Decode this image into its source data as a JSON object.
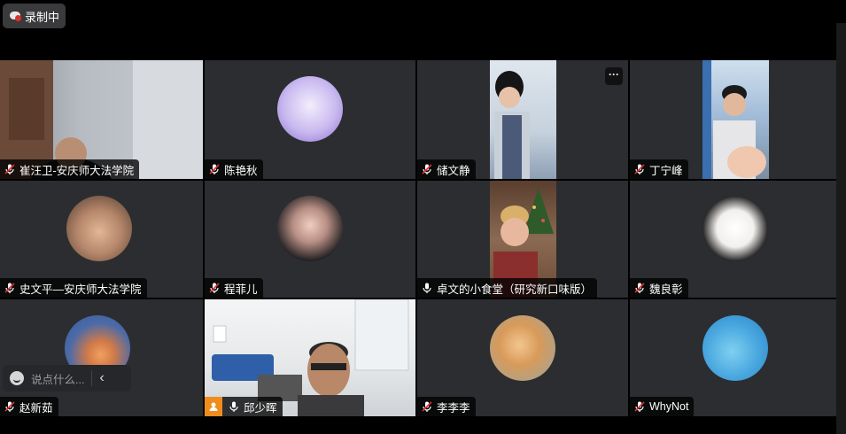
{
  "recording": {
    "label": "录制中",
    "icon": "recording-cloud-icon"
  },
  "tiles": [
    {
      "name": "崔汪卫-安庆师大法学院",
      "mic": "muted"
    },
    {
      "name": "陈艳秋",
      "mic": "muted"
    },
    {
      "name": "储文静",
      "mic": "muted"
    },
    {
      "name": "丁宁峰",
      "mic": "muted"
    },
    {
      "name": "史文平—安庆师大法学院",
      "mic": "muted"
    },
    {
      "name": "程菲儿",
      "mic": "muted"
    },
    {
      "name": "卓文的小食堂（研究新口味版）",
      "mic": "on"
    },
    {
      "name": "魏良彰",
      "mic": "muted"
    },
    {
      "name": "赵新茹",
      "mic": "muted"
    },
    {
      "name": "邱少晖",
      "mic": "on",
      "host": true,
      "active": true
    },
    {
      "name": "李李李",
      "mic": "muted"
    },
    {
      "name": "WhyNot",
      "mic": "muted"
    }
  ],
  "tile_menu": {
    "label": "···"
  },
  "chat": {
    "placeholder": "说点什么..."
  },
  "colors": {
    "active_speaker": "#2dbf62",
    "muted_icon": "#e03030",
    "tile_bg": "#2c2d30",
    "host_badge": "#f08c1e"
  }
}
